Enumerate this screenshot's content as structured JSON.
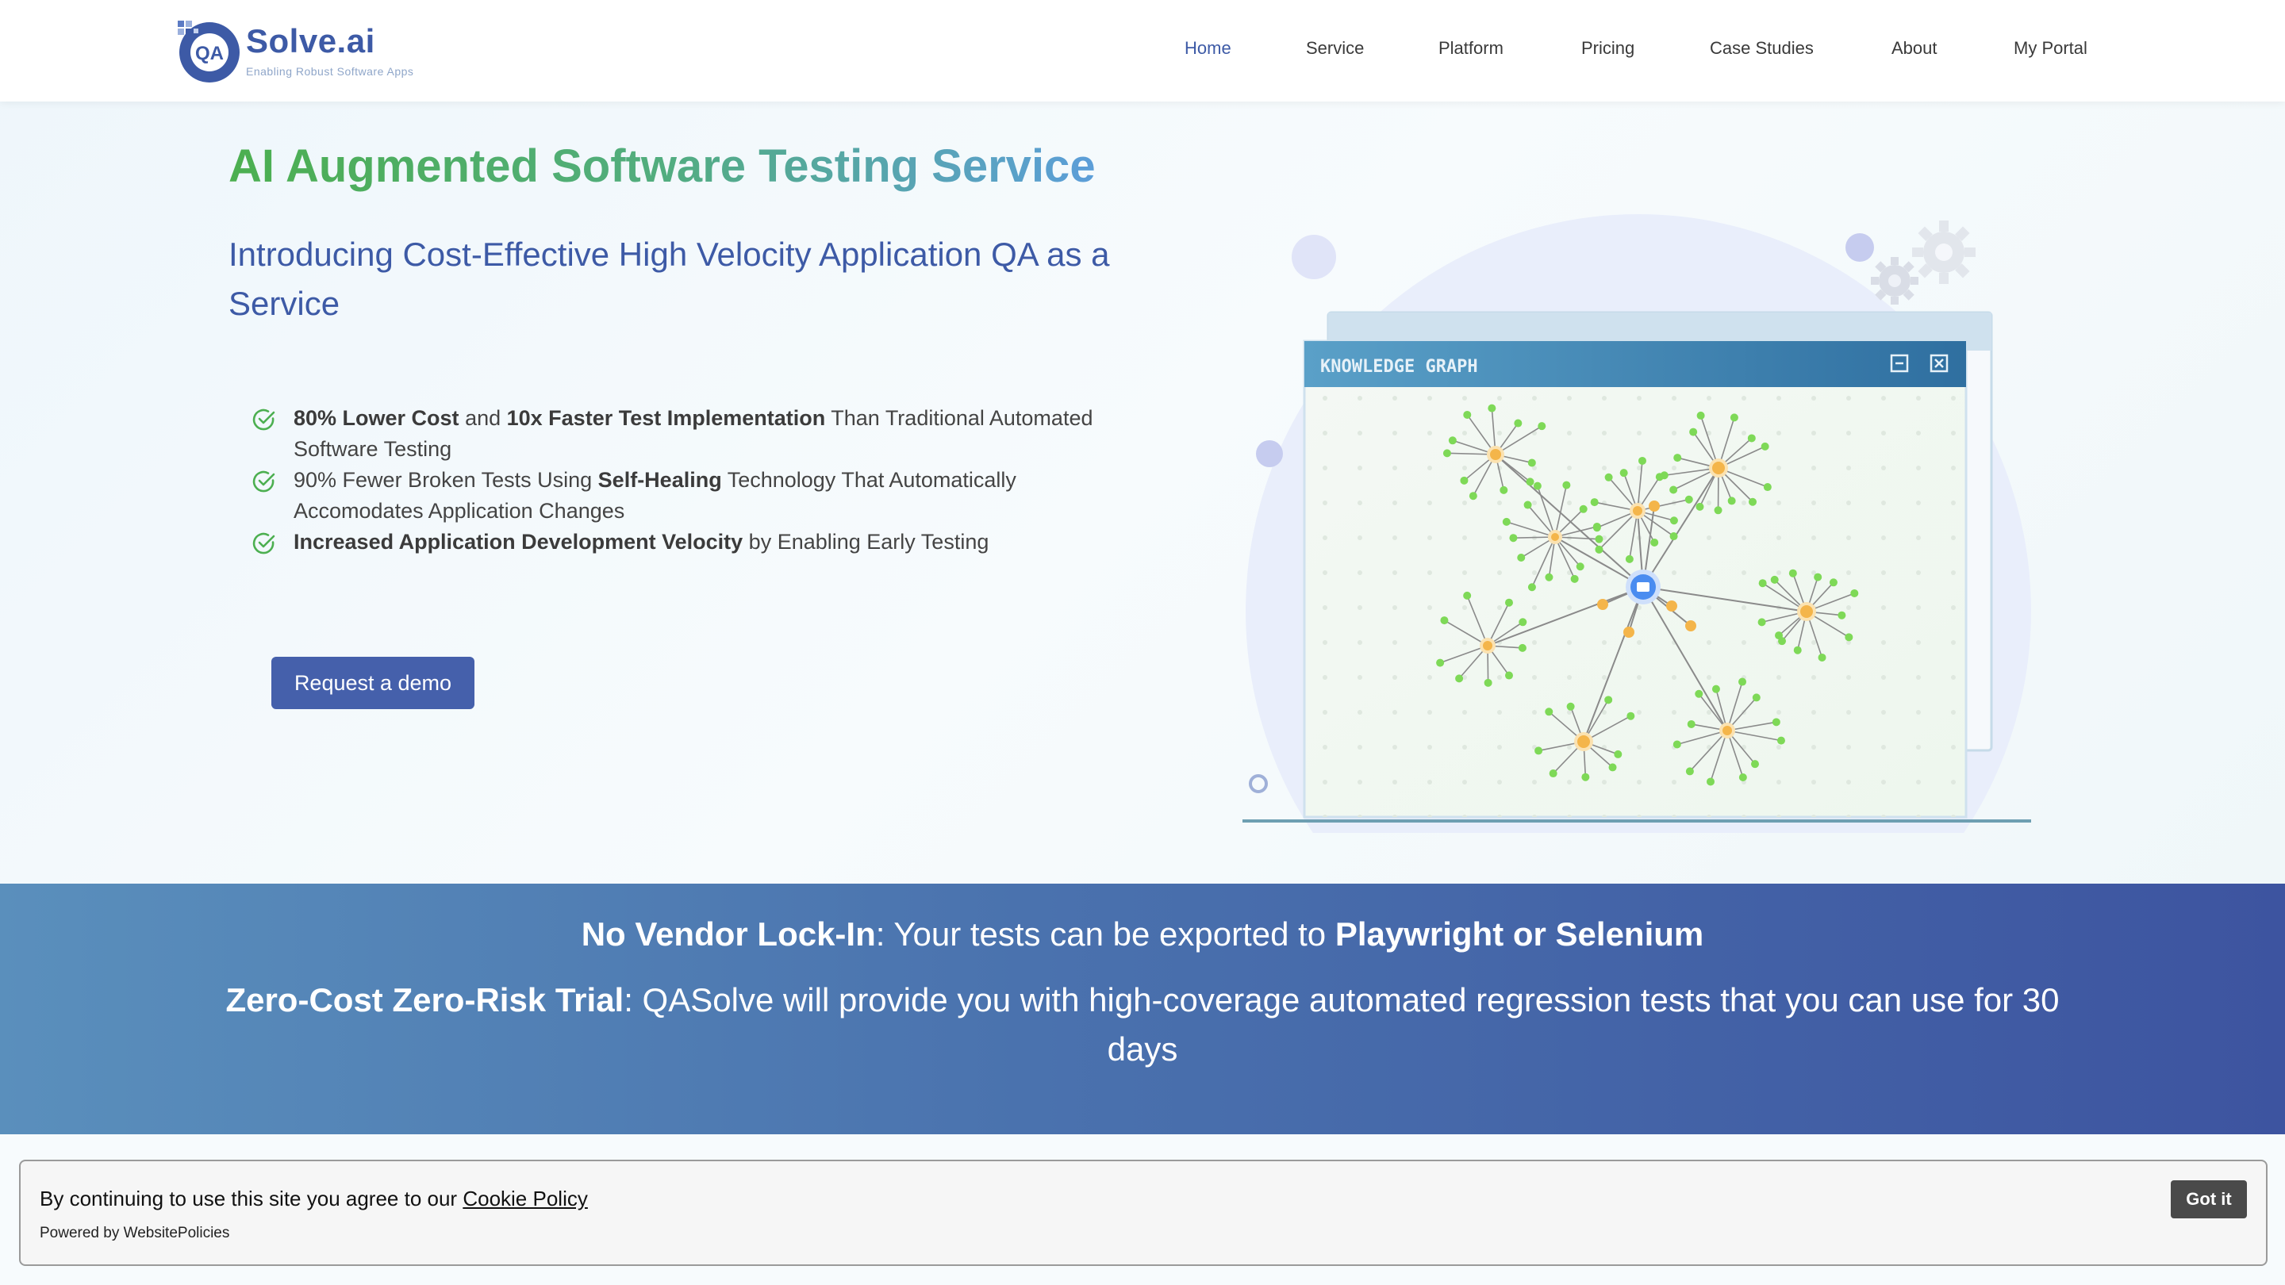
{
  "header": {
    "logo_text": "Solve.ai",
    "logo_letters": "QA",
    "tagline": "Enabling Robust Software Apps",
    "nav": [
      {
        "label": "Home",
        "active": true
      },
      {
        "label": "Service"
      },
      {
        "label": "Platform"
      },
      {
        "label": "Pricing"
      },
      {
        "label": "Case Studies"
      },
      {
        "label": "About"
      },
      {
        "label": "My Portal"
      }
    ]
  },
  "hero": {
    "title": "AI Augmented Software Testing Service",
    "subtitle": "Introducing Cost-Effective High Velocity Application QA as a Service",
    "bullets": [
      {
        "b1": "80% Lower Cost",
        "t1": " and ",
        "b2": "10x Faster Test Implementation",
        "t2": " Than Traditional Automated Software Testing"
      },
      {
        "t0": "90% Fewer Broken Tests Using ",
        "b1": "Self-Healing",
        "t1": " Technology That Automatically Accomodates Application Changes"
      },
      {
        "b1": " Increased Application Development Velocity",
        "t1": " by Enabling Early Testing"
      }
    ],
    "cta_label": "Request a demo"
  },
  "illustration": {
    "window_title": "KNOWLEDGE GRAPH",
    "icons": [
      "minimize-icon",
      "close-icon",
      "gear-icon"
    ],
    "colors": {
      "edge": "#8a8a8a",
      "leaf": "#7ed957",
      "hub": "#f4b54a",
      "center": "#4a8cf0",
      "titlebar": "#3a7fae"
    }
  },
  "banner": {
    "line1_bold": "No Vendor Lock-In",
    "line1_text": ": Your tests can be exported to ",
    "line1_bold2": "Playwright or Selenium",
    "line2_bold": "Zero-Cost Zero-Risk Trial",
    "line2_text": ": QASolve will provide you with high-coverage automated regression tests that you can use for 30 days"
  },
  "cookie": {
    "text": "By continuing to use this site you agree to our ",
    "link": "Cookie Policy",
    "powered": "Powered by WebsitePolicies",
    "button": "Got it"
  }
}
